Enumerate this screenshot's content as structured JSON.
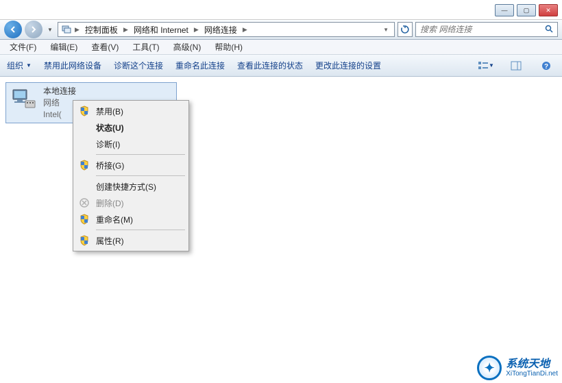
{
  "window_controls": {
    "min": "—",
    "max": "▢",
    "close": "✕"
  },
  "breadcrumb": [
    "控制面板",
    "网络和 Internet",
    "网络连接"
  ],
  "search": {
    "placeholder": "搜索 网络连接"
  },
  "menubar": [
    "文件(F)",
    "编辑(E)",
    "查看(V)",
    "工具(T)",
    "高级(N)",
    "帮助(H)"
  ],
  "toolbar": {
    "organize": "组织",
    "items": [
      "禁用此网络设备",
      "诊断这个连接",
      "重命名此连接",
      "查看此连接的状态",
      "更改此连接的设置"
    ]
  },
  "connection": {
    "title": "本地连接",
    "status": "网络",
    "adapter": "Intel("
  },
  "context_menu": [
    {
      "label": "禁用(B)",
      "shield": true
    },
    {
      "label": "状态(U)",
      "bold": true
    },
    {
      "label": "诊断(I)"
    },
    {
      "sep": true
    },
    {
      "label": "桥接(G)",
      "shield": true
    },
    {
      "sep": true
    },
    {
      "label": "创建快捷方式(S)"
    },
    {
      "label": "删除(D)",
      "disabled": true,
      "icon": "delete"
    },
    {
      "label": "重命名(M)",
      "shield": true
    },
    {
      "sep": true
    },
    {
      "label": "属性(R)",
      "shield": true
    }
  ],
  "watermark": {
    "cn": "系统天地",
    "en": "XiTongTianDi.net"
  }
}
